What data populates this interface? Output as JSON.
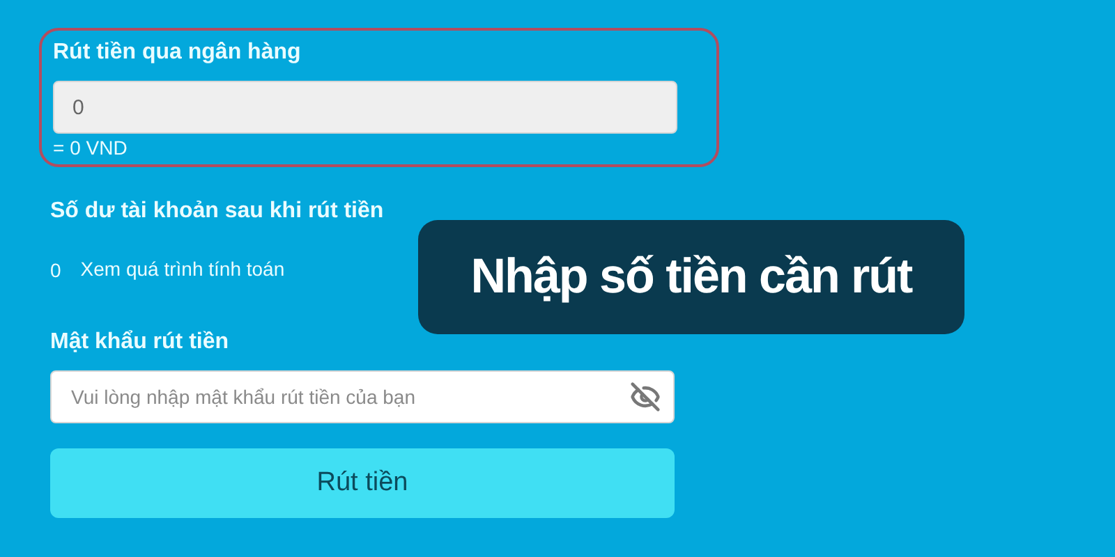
{
  "bank_withdrawal": {
    "label": "Rút tiền qua ngân hàng",
    "value": "0",
    "converted": "= 0 VND",
    "highlighted": true
  },
  "balance_after": {
    "label": "Số dư tài khoản sau khi rút tiền",
    "amount": "0",
    "link": "Xem quá trình tính toán"
  },
  "password": {
    "label": "Mật khẩu rút tiền",
    "placeholder": "Vui lòng nhập mật khẩu rút tiền của bạn",
    "visible": false
  },
  "submit_button": "Rút tiền",
  "caption": "Nhập số tiền cần rút"
}
